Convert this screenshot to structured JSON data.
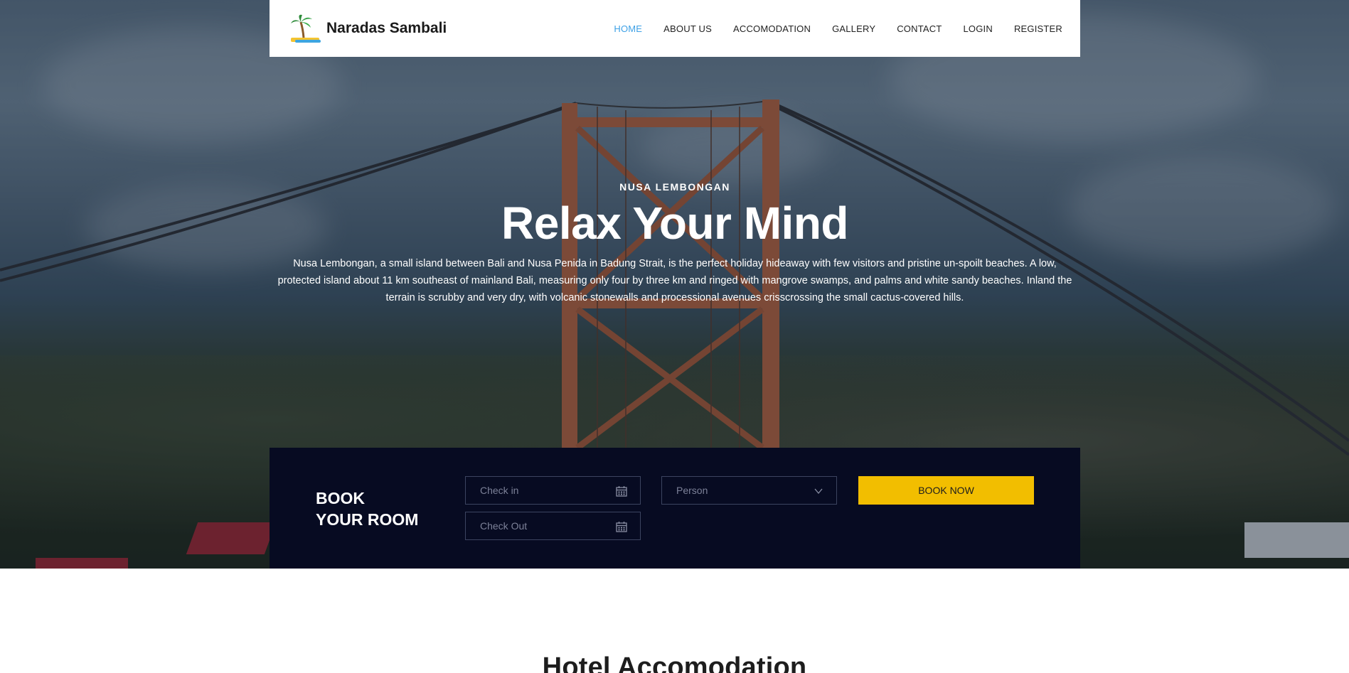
{
  "header": {
    "brand": "Naradas Sambali",
    "nav": [
      {
        "label": "HOME",
        "active": true
      },
      {
        "label": "ABOUT US"
      },
      {
        "label": "ACCOMODATION"
      },
      {
        "label": "GALLERY"
      },
      {
        "label": "CONTACT"
      },
      {
        "label": "LOGIN"
      },
      {
        "label": "REGISTER"
      }
    ]
  },
  "hero": {
    "eyebrow": "NUSA LEMBONGAN",
    "headline": "Relax Your Mind",
    "description": "Nusa Lembongan, a small island between Bali and Nusa Penida in Badung Strait, is the perfect holiday hideaway with few visitors and pristine un-spoilt beaches. A low, protected island about 11 km southeast of mainland Bali, measuring only four by three km and ringed with mangrove swamps, and palms and white sandy beaches. Inland the terrain is scrubby and very dry, with volcanic stonewalls and processional avenues crisscrossing the small cactus-covered hills."
  },
  "booking": {
    "title_line1": "BOOK",
    "title_line2": "YOUR ROOM",
    "check_in_placeholder": "Check in",
    "check_out_placeholder": "Check Out",
    "person_placeholder": "Person",
    "book_button": "BOOK NOW"
  },
  "section": {
    "title": "Hotel Accomodation"
  },
  "colors": {
    "accent_nav": "#3ea1e6",
    "booking_bg": "#070b22",
    "button_yellow": "#f2be00"
  }
}
